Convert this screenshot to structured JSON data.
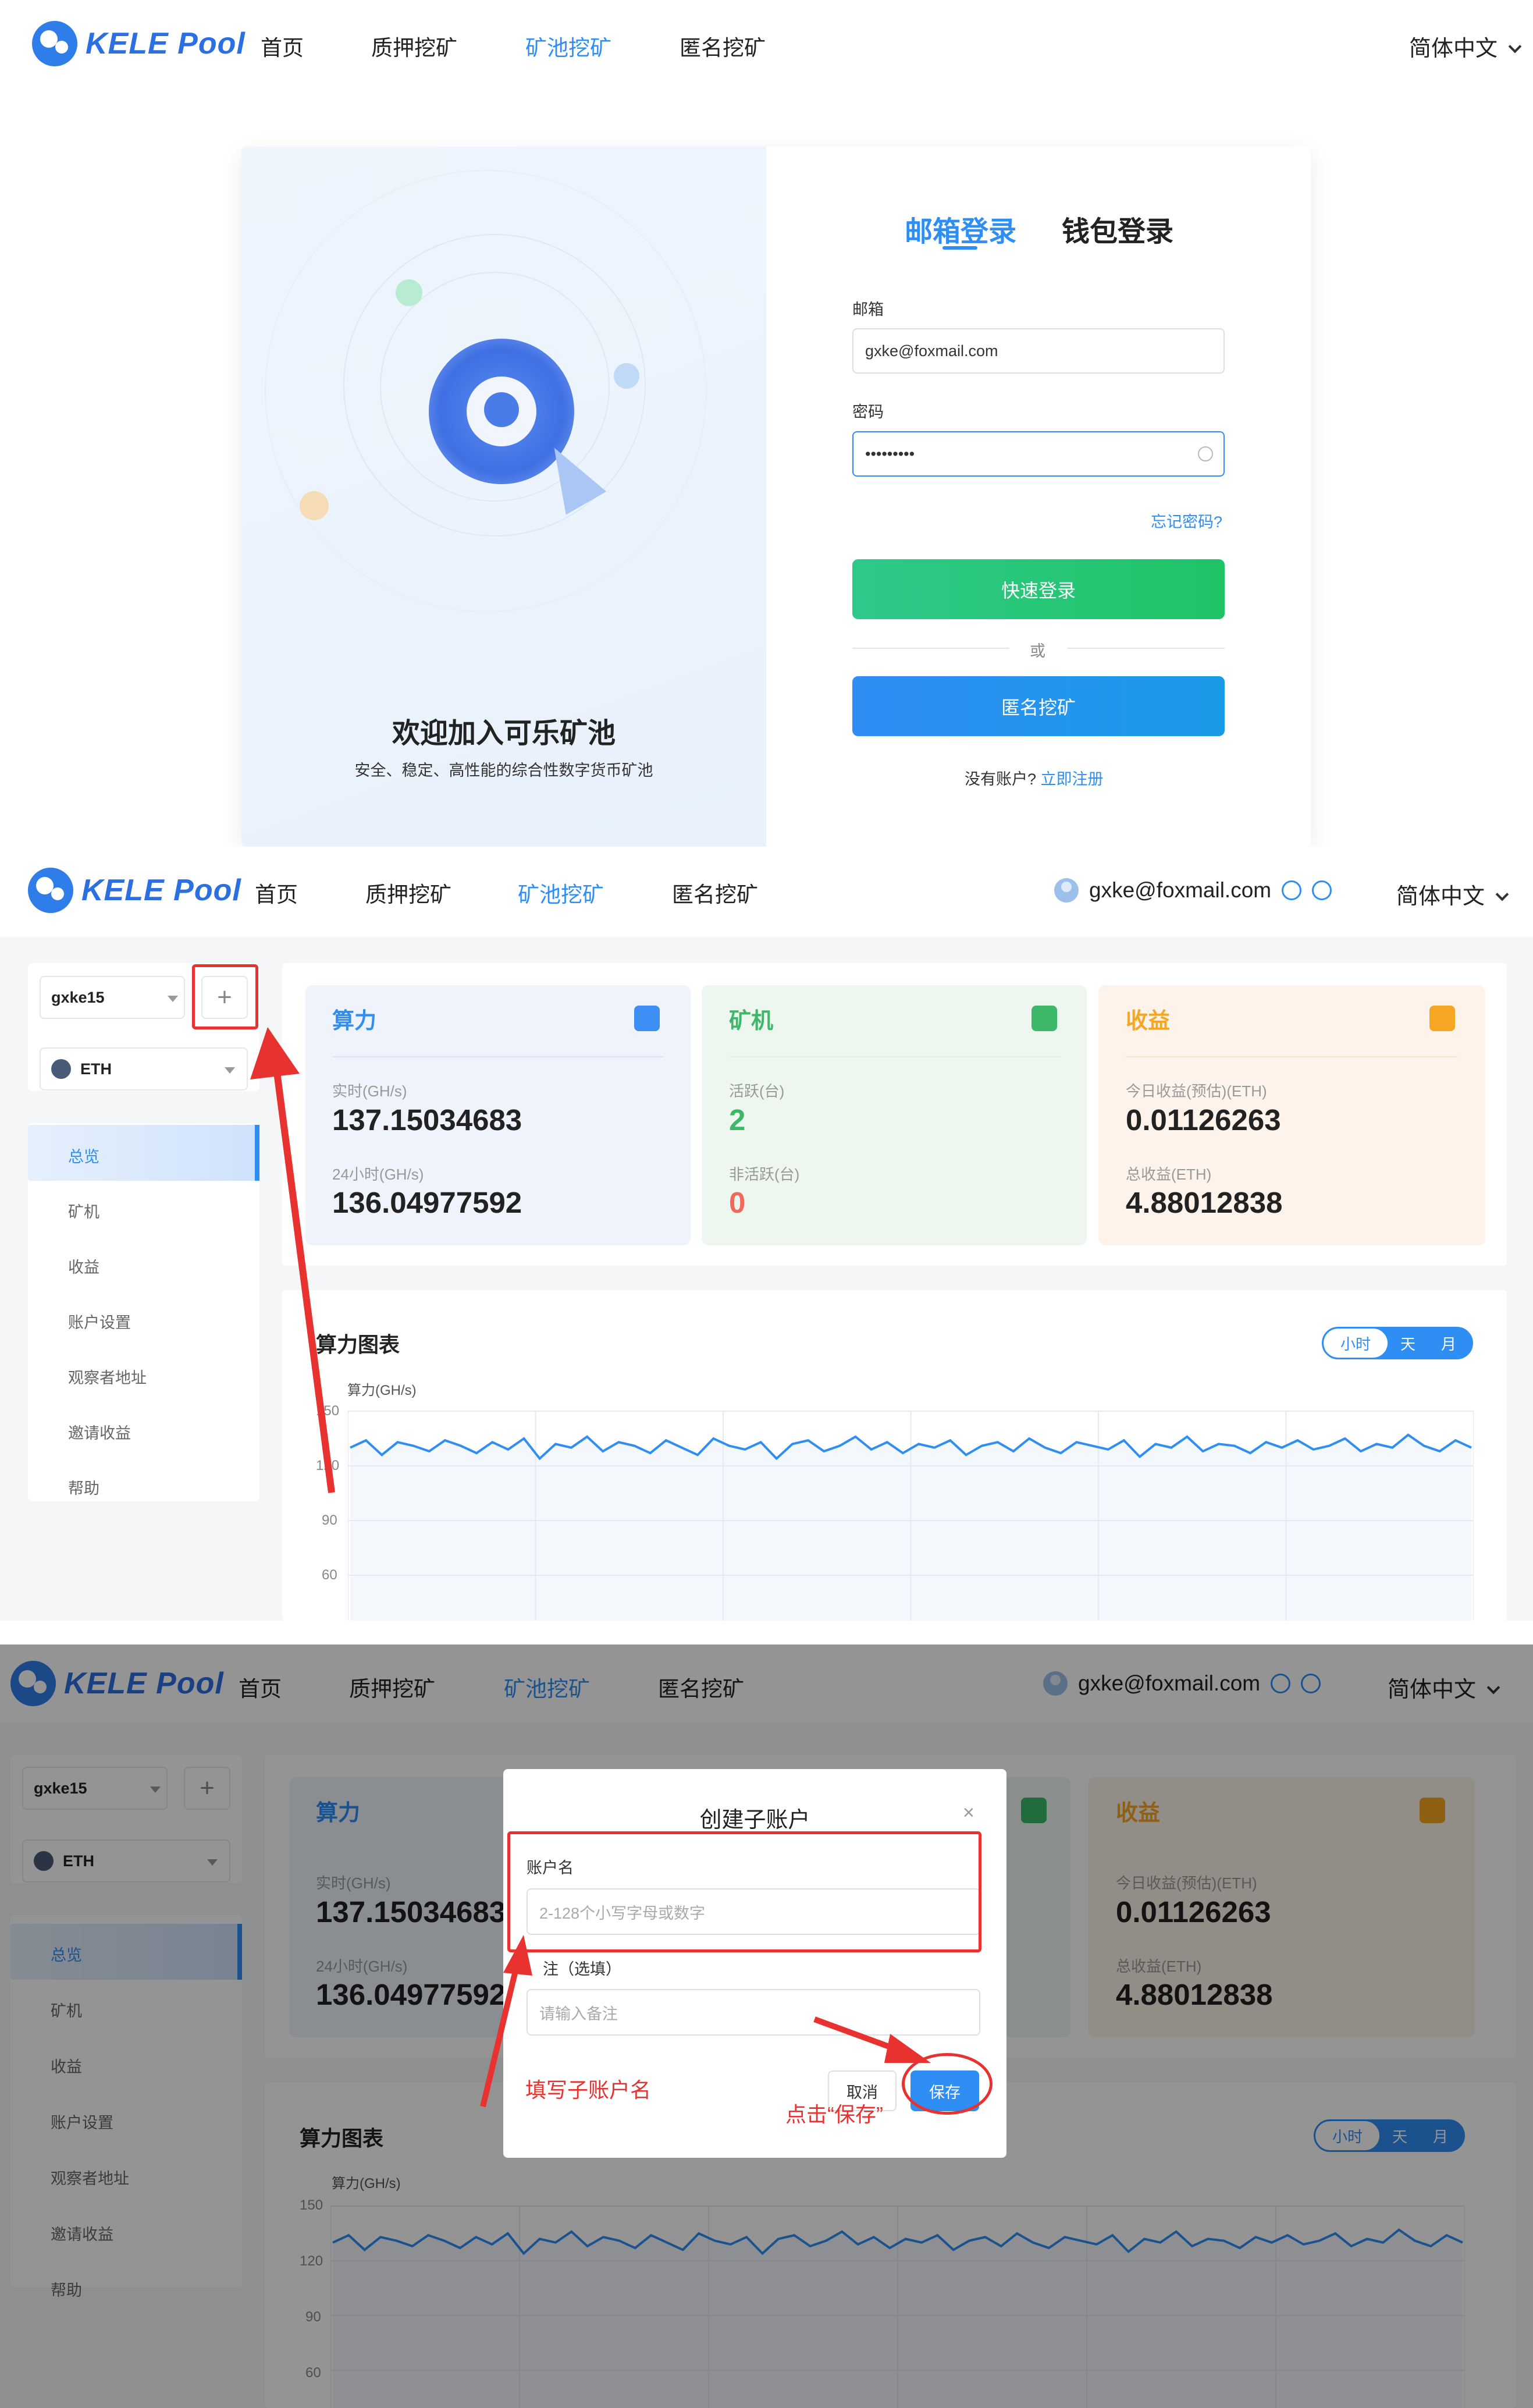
{
  "nav": {
    "logo": "KELE Pool",
    "items": [
      "首页",
      "质押挖矿",
      "矿池挖矿",
      "匿名挖矿"
    ],
    "active_index": 2,
    "lang": "简体中文"
  },
  "login": {
    "welcome": "欢迎加入可乐矿池",
    "welcome_sub": "安全、稳定、高性能的综合性数字货币矿池",
    "tab_email": "邮箱登录",
    "tab_wallet": "钱包登录",
    "email_label": "邮箱",
    "email_value": "gxke@foxmail.com",
    "password_label": "密码",
    "password_value": "•••••••••",
    "forgot": "忘记密码?",
    "quick_login": "快速登录",
    "or": "或",
    "anon_mining": "匿名挖矿",
    "no_account": "没有账户?",
    "register": "立即注册"
  },
  "dashboard": {
    "user_email": "gxke@foxmail.com",
    "sub_account": "gxke15",
    "coin": "ETH",
    "add_symbol": "+",
    "menu": [
      "总览",
      "矿机",
      "收益",
      "账户设置",
      "观察者地址",
      "邀请收益",
      "帮助"
    ],
    "hashrate": {
      "title": "算力",
      "realtime_label": "实时(GH/s)",
      "realtime_value": "137.15034683",
      "day_label": "24小时(GH/s)",
      "day_value": "136.04977592"
    },
    "miners": {
      "title": "矿机",
      "active_label": "活跃(台)",
      "active_value": "2",
      "inactive_label": "非活跃(台)",
      "inactive_value": "0"
    },
    "earnings": {
      "title": "收益",
      "today_label": "今日收益(预估)(ETH)",
      "today_value": "0.01126263",
      "total_label": "总收益(ETH)",
      "total_value": "4.88012838"
    },
    "chart": {
      "title": "算力图表",
      "ranges": [
        "小时",
        "天",
        "月"
      ],
      "active_range": "小时",
      "unit": "算力(GH/s)",
      "yticks": [
        "150",
        "120",
        "90",
        "60"
      ]
    }
  },
  "modal": {
    "title": "创建子账户",
    "close": "×",
    "name_label": "账户名",
    "name_placeholder": "2-128个小写字母或数字",
    "note_label": "备注（选填）",
    "note_label_visible": "注（选填）",
    "note_placeholder": "请输入备注",
    "cancel": "取消",
    "save": "保存"
  },
  "annotations": {
    "fill_name": "填写子账户名",
    "click_save": "点击“保存”"
  },
  "colors": {
    "accent": "#2f8ef4",
    "green": "#20c46a",
    "orange": "#f5a623",
    "red_annotation": "#e8322f"
  },
  "chart_data": [
    {
      "type": "line",
      "title": "算力图表",
      "ylabel": "算力(GH/s)",
      "ylim": [
        60,
        150
      ],
      "yticks": [
        150,
        120,
        90,
        60
      ],
      "series": [
        {
          "values": [
            130,
            134,
            126,
            133,
            131,
            128,
            134,
            131,
            127,
            133,
            129,
            135,
            124,
            132,
            130,
            136,
            128,
            133,
            131,
            127,
            134,
            130,
            126,
            135,
            131,
            129,
            133,
            124,
            132,
            134,
            128,
            131,
            136,
            129,
            133,
            127,
            132,
            130,
            134,
            126,
            131,
            133,
            128,
            135,
            130,
            127,
            133,
            131,
            129,
            134,
            125,
            132,
            130,
            136,
            128,
            132,
            131,
            127,
            133,
            130,
            134,
            129,
            131,
            135,
            128,
            132,
            130,
            137,
            131,
            128,
            134,
            130
          ]
        }
      ]
    },
    {
      "type": "line",
      "title": "算力图表",
      "ylabel": "算力(GH/s)",
      "ylim": [
        60,
        150
      ],
      "yticks": [
        150,
        120,
        90,
        60
      ],
      "series": [
        {
          "values": [
            130,
            134,
            126,
            133,
            131,
            128,
            134,
            131,
            127,
            133,
            129,
            135,
            124,
            132,
            130,
            136,
            128,
            133,
            131,
            127,
            134,
            130,
            126,
            135,
            131,
            129,
            133,
            124,
            132,
            134,
            128,
            131,
            136,
            129,
            133,
            127,
            132,
            130,
            134,
            126,
            131,
            133,
            128,
            135,
            130,
            127,
            133,
            131,
            129,
            134,
            125,
            132,
            130,
            136,
            128,
            132,
            131,
            127,
            133,
            130,
            134,
            129,
            131,
            135,
            128,
            132,
            130,
            137,
            131,
            128,
            134,
            130
          ]
        }
      ]
    }
  ]
}
